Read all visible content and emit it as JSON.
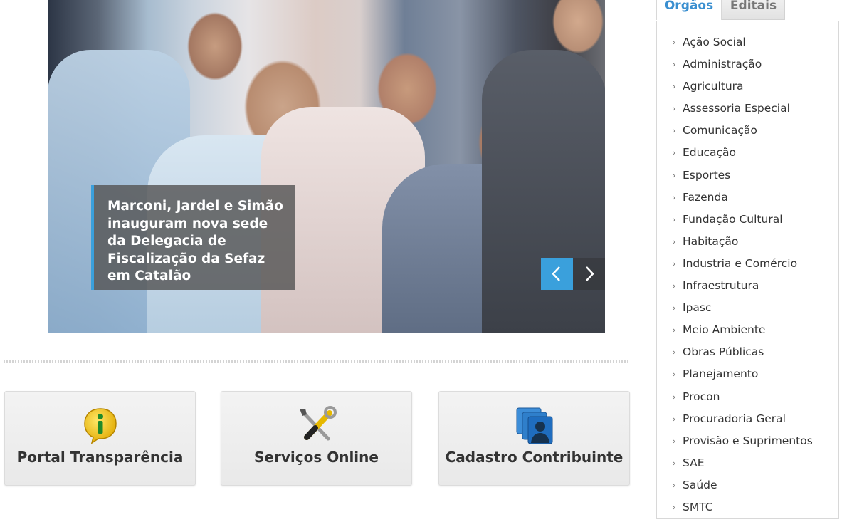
{
  "slider": {
    "caption": "Marconi, Jardel e Simão inauguram nova sede da Delegacia de Fiscalização da Sefaz em Catalão",
    "prev_icon": "chevron-left-icon",
    "next_icon": "chevron-right-icon",
    "accent_color": "#3aa0dc"
  },
  "tiles": [
    {
      "label": "Portal Transparência",
      "icon": "info-bubble-icon"
    },
    {
      "label": "Serviços Online",
      "icon": "tools-icon"
    },
    {
      "label": "Cadastro Contribuinte",
      "icon": "user-profiles-icon"
    }
  ],
  "sidebar": {
    "tabs": [
      {
        "label": "Orgãos",
        "active": true
      },
      {
        "label": "Editais",
        "active": false
      }
    ],
    "items": [
      "Ação Social",
      "Administração",
      "Agricultura",
      "Assessoria Especial",
      "Comunicação",
      "Educação",
      "Esportes",
      "Fazenda",
      "Fundação Cultural",
      "Habitação",
      "Industria e Comércio",
      "Infraestrutura",
      "Ipasc",
      "Meio Ambiente",
      "Obras Públicas",
      "Planejamento",
      "Procon",
      "Procuradoria Geral",
      "Provisão e Suprimentos",
      "SAE",
      "Saúde",
      "SMTC"
    ]
  }
}
